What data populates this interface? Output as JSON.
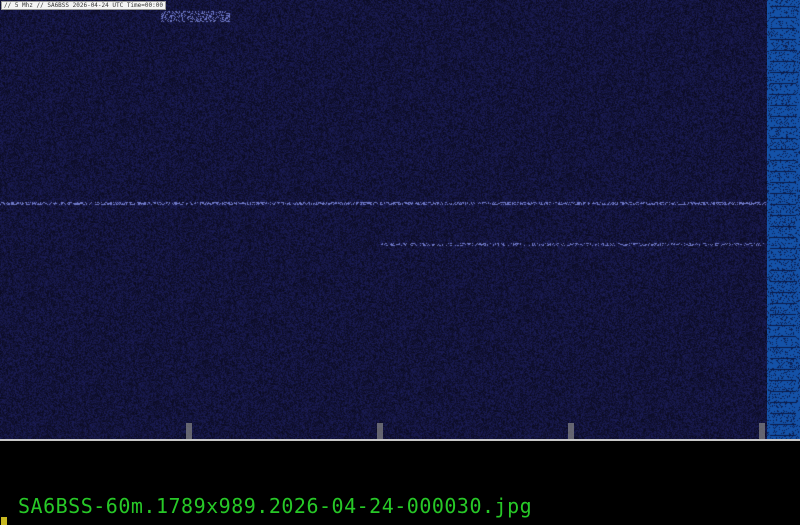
{
  "viewer": {
    "header_label": "// 5 Mhz // SA6BSS 2026-04-24 UTC Time=00:00",
    "filename": "SA6BSS-60m.1789x989.2026-04-24-000030.jpg"
  },
  "colors": {
    "background": "#0b0b2a",
    "scale_strip": "#1452a8",
    "filename_text": "#27c927",
    "cursor": "#c8b820"
  }
}
